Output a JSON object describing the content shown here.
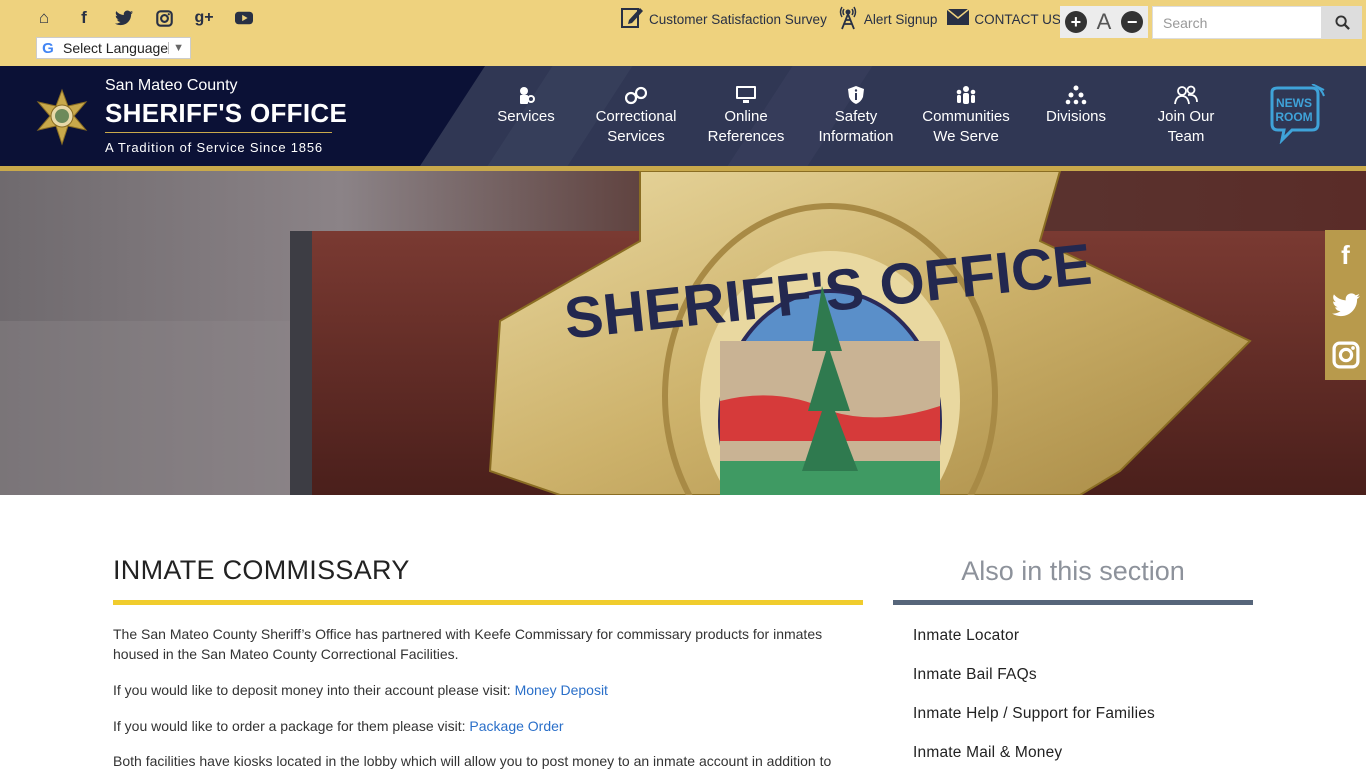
{
  "topbar": {
    "social_icons": [
      "home-icon",
      "facebook-icon",
      "twitter-icon",
      "instagram-icon",
      "google-plus-icon",
      "youtube-icon"
    ],
    "language": {
      "g_mark": "G",
      "label": "Select Language",
      "arrow": "▼"
    },
    "links": [
      {
        "icon": "survey-icon",
        "label": "Customer Satisfaction Survey"
      },
      {
        "icon": "alert-icon",
        "label": "Alert Signup"
      },
      {
        "icon": "envelope-icon",
        "label": "CONTACT US"
      }
    ],
    "font_controls": {
      "increase": "+",
      "reset": "A",
      "decrease": "−"
    },
    "search": {
      "placeholder": "Search",
      "value": ""
    }
  },
  "brand": {
    "county": "San Mateo County",
    "office": "SHERIFF'S OFFICE",
    "tagline": "A Tradition of Service Since 1856"
  },
  "nav": {
    "items": [
      {
        "icon": "services-icon",
        "line1": "Services",
        "line2": ""
      },
      {
        "icon": "handcuffs-icon",
        "line1": "Correctional",
        "line2": "Services"
      },
      {
        "icon": "monitor-icon",
        "line1": "Online",
        "line2": "References"
      },
      {
        "icon": "info-shield-icon",
        "line1": "Safety",
        "line2": "Information"
      },
      {
        "icon": "people-icon",
        "line1": "Communities",
        "line2": "We Serve"
      },
      {
        "icon": "org-chart-icon",
        "line1": "Divisions",
        "line2": ""
      },
      {
        "icon": "team-icon",
        "line1": "Join Our",
        "line2": "Team"
      }
    ],
    "newsroom": {
      "line1": "NEWS",
      "line2": "ROOM"
    }
  },
  "hero": {
    "badge_text": "SHERIFF'S OFFICE"
  },
  "side_social": [
    "facebook-icon",
    "twitter-icon",
    "instagram-icon"
  ],
  "main": {
    "title": "INMATE COMMISSARY",
    "p1": "The San Mateo County Sheriff’s Office has partnered with Keefe Commissary for commissary products for inmates housed in the San Mateo County Correctional Facilities.",
    "p2_text": "If you would like to deposit money into their account please visit: ",
    "p2_link": "Money Deposit",
    "p3_text": "If you would like to order a package for them please visit: ",
    "p3_link": "Package Order",
    "p4": "Both facilities have kiosks located in the lobby which will allow you to post money to an inmate account in addition to"
  },
  "aside": {
    "title": "Also in this section",
    "links": [
      "Inmate Locator",
      "Inmate Bail FAQs",
      "Inmate Help / Support for Families",
      "Inmate Mail & Money"
    ]
  },
  "colors": {
    "topbar": "#eed27e",
    "nav": "#303754",
    "brand_bg": "#0b1136",
    "gold": "#c9a94b",
    "title_underline": "#f0cc2d",
    "link": "#2a6fc9"
  }
}
